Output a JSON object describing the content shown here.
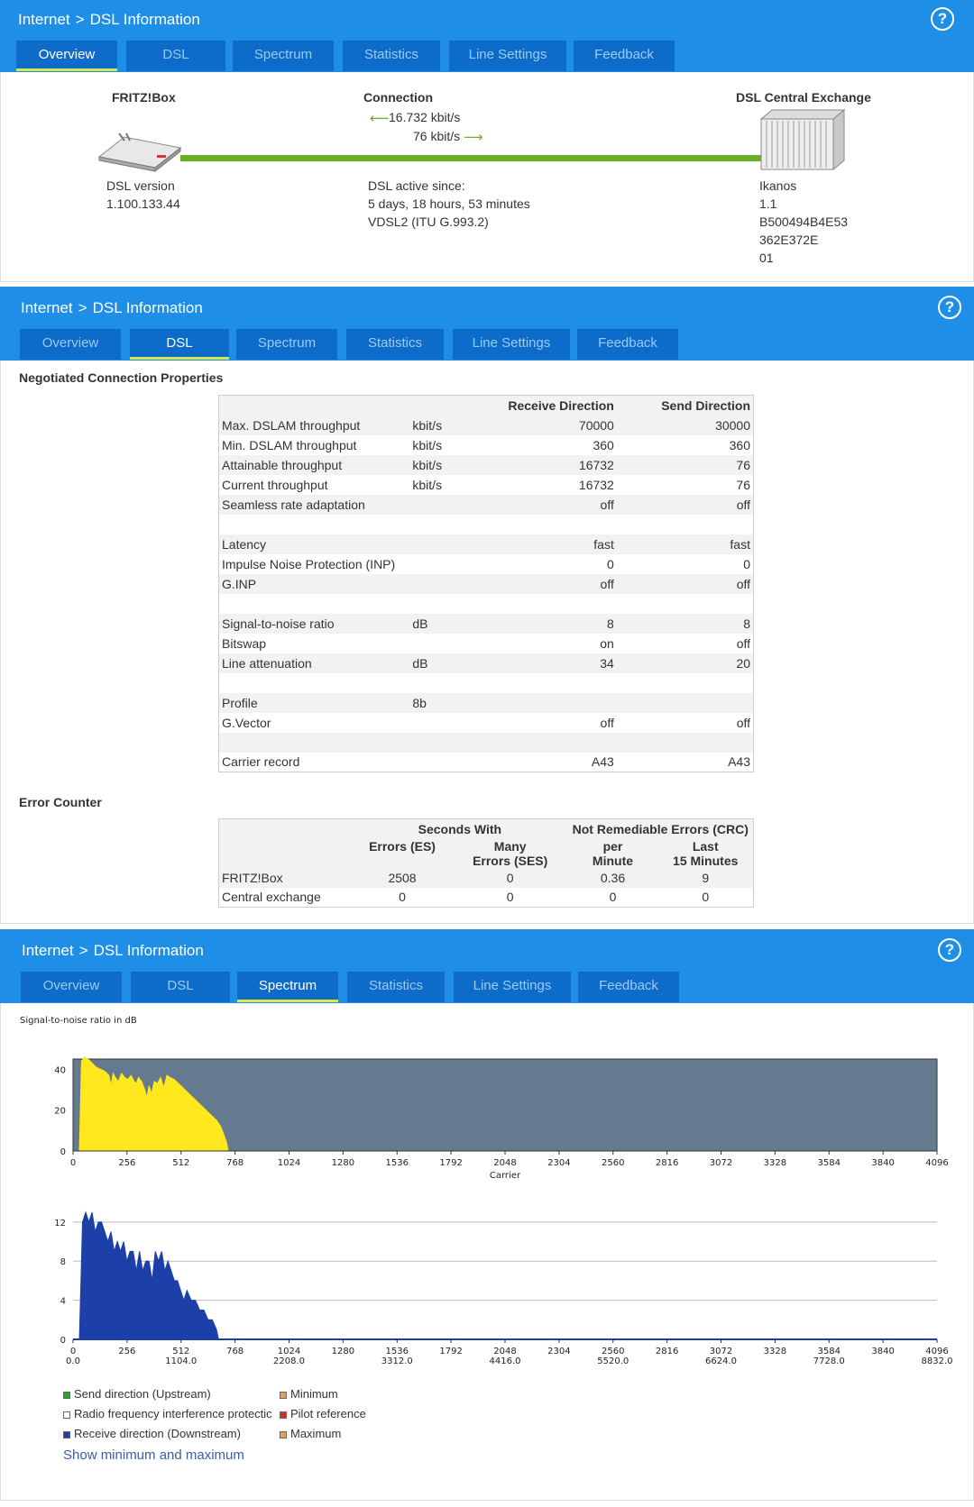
{
  "breadcrumb": {
    "root": "Internet",
    "sep": ">",
    "page": "DSL Information"
  },
  "help_label": "?",
  "tabs": [
    "Overview",
    "DSL",
    "Spectrum",
    "Statistics",
    "Line Settings",
    "Feedback"
  ],
  "overview": {
    "fritzbox_title": "FRITZ!Box",
    "connection_title": "Connection",
    "exchange_title": "DSL Central Exchange",
    "down_rate": "16.732 kbit/s",
    "up_rate": "76 kbit/s",
    "dsl_version_label": "DSL version",
    "dsl_version": "1.100.133.44",
    "active_since_label": "DSL active since:",
    "active_since": "5 days, 18 hours, 53 minutes",
    "mode": "VDSL2 (ITU G.993.2)",
    "exchange_lines": [
      "Ikanos",
      "1.1",
      "B500494B4E53",
      "362E372E",
      "01"
    ],
    "colors": {
      "line": "#6ab023",
      "arrow": "#6ab023"
    }
  },
  "dsl": {
    "neg_title": "Negotiated Connection Properties",
    "neg_headers": [
      "",
      "",
      "Receive Direction",
      "Send Direction"
    ],
    "neg_rows": [
      [
        "Max. DSLAM throughput",
        "kbit/s",
        "70000",
        "30000"
      ],
      [
        "Min. DSLAM throughput",
        "kbit/s",
        "360",
        "360"
      ],
      [
        "Attainable throughput",
        "kbit/s",
        "16732",
        "76"
      ],
      [
        "Current throughput",
        "kbit/s",
        "16732",
        "76"
      ],
      [
        "Seamless rate adaptation",
        "",
        "off",
        "off"
      ],
      [
        "",
        "",
        "",
        ""
      ],
      [
        "Latency",
        "",
        "fast",
        "fast"
      ],
      [
        "Impulse Noise Protection (INP)",
        "",
        "0",
        "0"
      ],
      [
        "G.INP",
        "",
        "off",
        "off"
      ],
      [
        "",
        "",
        "",
        ""
      ],
      [
        "Signal-to-noise ratio",
        "dB",
        "8",
        "8"
      ],
      [
        "Bitswap",
        "",
        "on",
        "off"
      ],
      [
        "Line attenuation",
        "dB",
        "34",
        "20"
      ],
      [
        "",
        "",
        "",
        ""
      ],
      [
        "Profile",
        "8b",
        "",
        ""
      ],
      [
        "G.Vector",
        "",
        "off",
        "off"
      ],
      [
        "",
        "",
        "",
        ""
      ],
      [
        "Carrier record",
        "",
        "A43",
        "A43"
      ]
    ],
    "err_title": "Error Counter",
    "err_group1": "Seconds With",
    "err_group2": "Not Remediable Errors (CRC)",
    "err_sub": [
      [
        "Errors (ES)",
        ""
      ],
      [
        "Many",
        "Errors (SES)"
      ],
      [
        "per",
        "Minute"
      ],
      [
        "Last",
        "15 Minutes"
      ]
    ],
    "err_rows": [
      [
        "FRITZ!Box",
        "2508",
        "0",
        "0.36",
        "9"
      ],
      [
        "Central exchange",
        "0",
        "0",
        "0",
        "0"
      ]
    ]
  },
  "spectrum": {
    "legend": [
      {
        "label": "Send direction (Upstream)",
        "color": "#28a828"
      },
      {
        "label": "Minimum",
        "color": "#e0a060"
      },
      {
        "label": "Radio frequency interference protectic",
        "color": "#ffffff"
      },
      {
        "label": "Pilot reference",
        "color": "#d03020"
      },
      {
        "label": "Receive direction (Downstream)",
        "color": "#1c3fa8"
      },
      {
        "label": "Maximum",
        "color": "#e0a060"
      }
    ],
    "show_link": "Show minimum and maximum"
  },
  "chart_data": [
    {
      "type": "area",
      "title": "Signal-to-noise ratio in dB",
      "xlabel": "Carrier",
      "ylabel": "",
      "xlim": [
        0,
        4096
      ],
      "ylim": [
        0,
        45
      ],
      "xticks": [
        0,
        256,
        512,
        768,
        1024,
        1280,
        1536,
        1792,
        2048,
        2304,
        2560,
        2816,
        3072,
        3328,
        3584,
        3840,
        4096
      ],
      "yticks": [
        0,
        20,
        40
      ],
      "background": "#667a8f",
      "color": "#ffe81e",
      "series": [
        {
          "x": [
            30,
            40,
            55,
            70,
            90,
            110,
            130,
            150,
            170,
            180,
            190,
            200,
            215,
            230,
            245,
            260,
            275,
            290,
            300,
            310,
            325,
            340,
            350,
            360,
            372,
            385,
            400,
            415,
            430,
            445,
            460,
            480,
            500,
            520,
            540,
            560,
            580,
            600,
            620,
            640,
            660,
            680,
            700,
            715,
            728,
            735
          ],
          "y": [
            0,
            44,
            46,
            45,
            43,
            41,
            40,
            39,
            37,
            32,
            38,
            36,
            34,
            38,
            36,
            35,
            37,
            34,
            33,
            36,
            34,
            30,
            26,
            32,
            28,
            34,
            33,
            36,
            31,
            37,
            36,
            35,
            33,
            31,
            29,
            27,
            25,
            23,
            21,
            19,
            17,
            15,
            12,
            8,
            4,
            0
          ]
        }
      ]
    },
    {
      "type": "area",
      "title": "",
      "xlabel": "",
      "ylabel": "",
      "xlim": [
        0,
        4096
      ],
      "ylim": [
        0,
        13
      ],
      "xticks": [
        0,
        256,
        512,
        768,
        1024,
        1280,
        1536,
        1792,
        2048,
        2304,
        2560,
        2816,
        3072,
        3328,
        3584,
        3840,
        4096
      ],
      "xticks2": [
        "0.0",
        "1104.0",
        "2208.0",
        "3312.0",
        "4416.0",
        "5520.0",
        "6624.0",
        "7728.0",
        "8832.0"
      ],
      "yticks": [
        0,
        4,
        8,
        12
      ],
      "color": "#1c3fa8",
      "series": [
        {
          "x": [
            30,
            45,
            60,
            75,
            90,
            105,
            120,
            135,
            150,
            165,
            180,
            195,
            210,
            225,
            240,
            255,
            270,
            285,
            300,
            315,
            330,
            345,
            360,
            375,
            390,
            405,
            420,
            435,
            450,
            465,
            480,
            495,
            510,
            525,
            540,
            560,
            580,
            600,
            620,
            640,
            660,
            680,
            690
          ],
          "y": [
            0,
            12,
            13,
            12,
            13,
            11,
            12,
            12,
            11,
            10,
            11,
            9,
            10,
            9,
            10,
            8,
            9,
            9,
            7,
            9,
            7,
            8,
            8,
            6,
            9,
            8,
            9,
            7,
            8,
            7,
            6,
            6,
            5,
            4,
            5,
            4,
            4,
            3,
            3,
            2,
            2,
            1,
            0
          ]
        }
      ]
    }
  ]
}
